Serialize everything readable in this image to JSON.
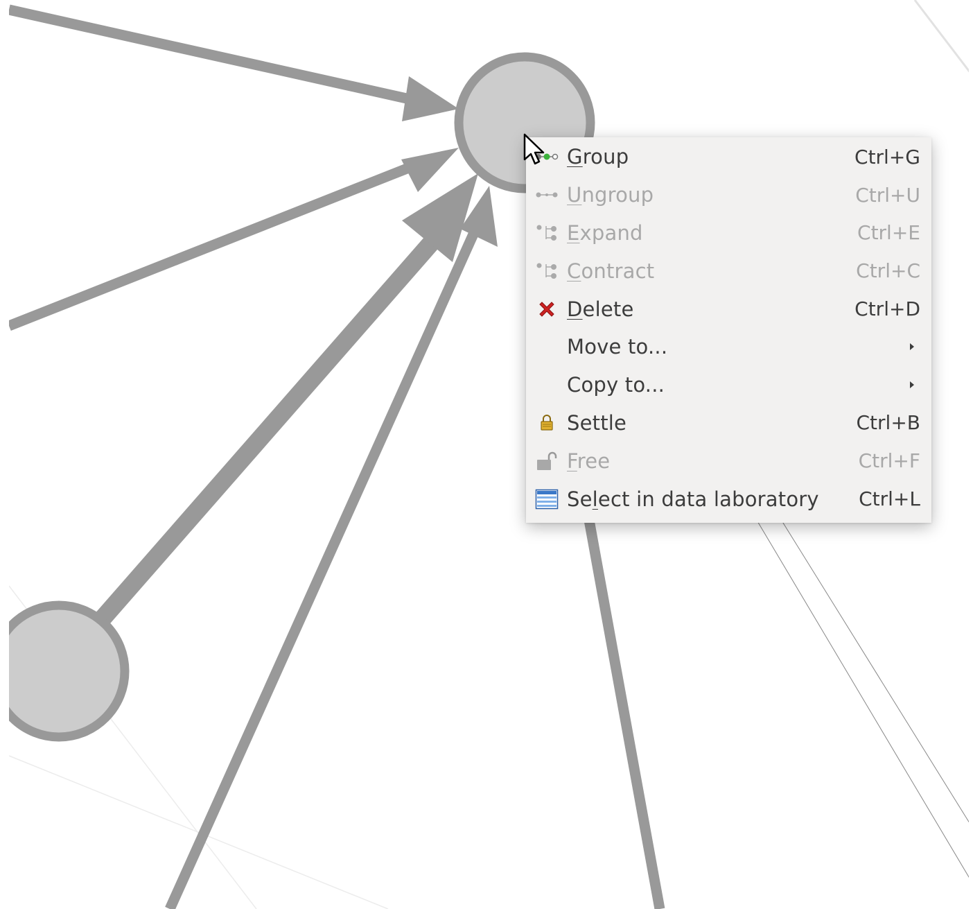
{
  "menu": {
    "items": [
      {
        "id": "group",
        "pre": "",
        "mnemonic": "G",
        "post": "roup",
        "shortcut": "Ctrl+G",
        "enabled": true,
        "icon": "group-icon"
      },
      {
        "id": "ungroup",
        "pre": "",
        "mnemonic": "U",
        "post": "ngroup",
        "shortcut": "Ctrl+U",
        "enabled": false,
        "icon": "ungroup-icon"
      },
      {
        "id": "expand",
        "pre": "",
        "mnemonic": "E",
        "post": "xpand",
        "shortcut": "Ctrl+E",
        "enabled": false,
        "icon": "expand-icon"
      },
      {
        "id": "contract",
        "pre": "",
        "mnemonic": "C",
        "post": "ontract",
        "shortcut": "Ctrl+C",
        "enabled": false,
        "icon": "contract-icon"
      },
      {
        "id": "delete",
        "pre": "",
        "mnemonic": "D",
        "post": "elete",
        "shortcut": "Ctrl+D",
        "enabled": true,
        "icon": "delete-icon"
      },
      {
        "id": "move-to",
        "pre": "Move to...",
        "mnemonic": "",
        "post": "",
        "shortcut": "",
        "submenu": true,
        "enabled": true,
        "icon": ""
      },
      {
        "id": "copy-to",
        "pre": "Copy to...",
        "mnemonic": "",
        "post": "",
        "shortcut": "",
        "submenu": true,
        "enabled": true,
        "icon": ""
      },
      {
        "id": "settle",
        "pre": "Settle",
        "mnemonic": "",
        "post": "",
        "shortcut": "Ctrl+B",
        "enabled": true,
        "icon": "lock-icon"
      },
      {
        "id": "free",
        "pre": "",
        "mnemonic": "F",
        "post": "ree",
        "shortcut": "Ctrl+F",
        "enabled": false,
        "icon": "unlock-icon"
      },
      {
        "id": "select-data-lab",
        "pre": "Se",
        "mnemonic": "l",
        "post": "ect in data laboratory",
        "shortcut": "Ctrl+L",
        "enabled": true,
        "icon": "table-icon"
      }
    ]
  },
  "colors": {
    "edge": "#999999",
    "node_fill": "#cccccc",
    "node_stroke": "#999999",
    "menu_bg": "#f2f1f0",
    "delete_red": "#cc2222"
  }
}
